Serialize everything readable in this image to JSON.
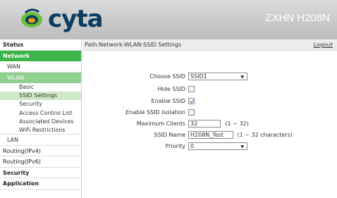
{
  "header": {
    "brand": "cyta",
    "model": "ZXHN H208N",
    "colors": {
      "brand_text": "#0a3d62",
      "brand_green": "#6bbf3a",
      "brand_orange": "#f39c12"
    }
  },
  "sidebar": {
    "items": [
      {
        "label": "Status"
      },
      {
        "label": "Network"
      },
      {
        "label": "WAN"
      },
      {
        "label": "WLAN"
      },
      {
        "label": "Basic"
      },
      {
        "label": "SSID Settings"
      },
      {
        "label": "Security"
      },
      {
        "label": "Access Control List"
      },
      {
        "label": "Associated Devices"
      },
      {
        "label": "WiFi Restrictions"
      },
      {
        "label": "LAN"
      },
      {
        "label": "Routing(IPv4)"
      },
      {
        "label": "Routing(IPv6)"
      },
      {
        "label": "Security"
      },
      {
        "label": "Application"
      }
    ],
    "colors": {
      "active_top": "#3bb54a",
      "active_l1": "#8fd08f",
      "active_l2": "#cfe9c6"
    }
  },
  "pathbar": {
    "path": "Path:Network-WLAN-SSID Settings",
    "logout": "Logout"
  },
  "form": {
    "choose_ssid": {
      "label": "Choose SSID",
      "value": "SSID1"
    },
    "hide_ssid": {
      "label": "Hide SSID",
      "checked": false
    },
    "enable_ssid": {
      "label": "Enable SSID",
      "checked": true
    },
    "enable_isolation": {
      "label": "Enable SSID Isolation",
      "checked": false
    },
    "max_clients": {
      "label": "Maximum Clients",
      "value": "32",
      "hint": "(1 ~ 32)"
    },
    "ssid_name": {
      "label": "SSID Name",
      "value": "H208N_Test",
      "hint": "(1 ~ 32 characters)"
    },
    "priority": {
      "label": "Priority",
      "value": "0"
    }
  },
  "icons": {
    "dropdown": "chevron-down-icon",
    "logo": "cyta-logo-icon"
  }
}
